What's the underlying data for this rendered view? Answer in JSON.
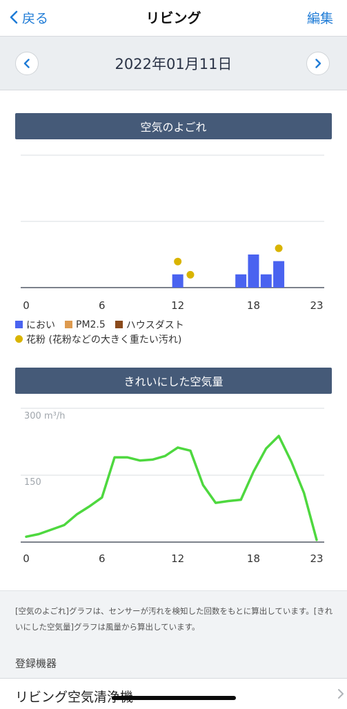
{
  "nav": {
    "back_label": "戻る",
    "title": "リビング",
    "edit_label": "編集"
  },
  "date": {
    "text": "2022年01月11日"
  },
  "sections": {
    "air_dirt_title": "空気のよごれ",
    "cleaned_title": "きれいにした空気量"
  },
  "chart_data": [
    {
      "type": "bar",
      "title": "空気のよごれ",
      "x_ticks": [
        0,
        6,
        12,
        18,
        23
      ],
      "xlim": [
        0,
        23
      ],
      "series": [
        {
          "name": "におい",
          "color": "#4a63f0",
          "hours": [
            12,
            17,
            18,
            19,
            20
          ],
          "values": [
            2,
            2,
            5,
            2,
            4
          ]
        },
        {
          "name": "PM2.5",
          "color": "#dd9a4f",
          "hours": [],
          "values": []
        },
        {
          "name": "ハウスダスト",
          "color": "#8a4a1c",
          "hours": [],
          "values": []
        },
        {
          "name": "花粉 (花粉などの大きく重たい汚れ)",
          "color": "#d9b400",
          "hours": [
            12,
            13,
            20
          ],
          "values": [
            3,
            1,
            5
          ]
        }
      ],
      "grid": true
    },
    {
      "type": "line",
      "title": "きれいにした空気量",
      "y_ticks": [
        "300 m³/h",
        "150"
      ],
      "ylim": [
        0,
        300
      ],
      "x_ticks": [
        0,
        6,
        12,
        18,
        23
      ],
      "series": [
        {
          "color": "#4ed83f",
          "x": [
            0,
            1,
            2,
            3,
            4,
            5,
            6,
            7,
            8,
            9,
            10,
            11,
            12,
            13,
            14,
            15,
            16,
            17,
            18,
            19,
            20,
            21,
            22,
            23
          ],
          "y": [
            12,
            18,
            28,
            38,
            62,
            80,
            100,
            190,
            190,
            183,
            185,
            193,
            212,
            205,
            128,
            88,
            92,
            95,
            158,
            210,
            238,
            180,
            110,
            5
          ]
        }
      ],
      "grid": true
    }
  ],
  "legend": {
    "odor": "におい",
    "pm25": "PM2.5",
    "dust": "ハウスダスト",
    "pollen": "花粉 (花粉などの大きく重たい汚れ)"
  },
  "notes": {
    "text": "[空気のよごれ]グラフは、センサーが汚れを検知した回数をもとに算出しています。[きれいにした空気量]グラフは風量から算出しています。",
    "registered_label": "登録機器",
    "device_name": "リビング空気清浄機"
  }
}
